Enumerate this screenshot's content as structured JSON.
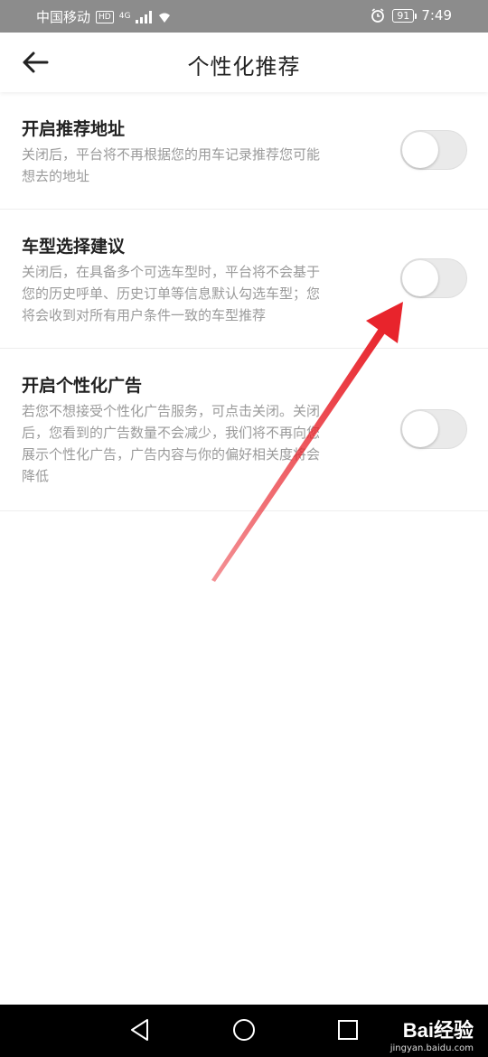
{
  "status_bar": {
    "carrier": "中国移动",
    "hd": "HD",
    "network": "4G",
    "battery": "91",
    "time": "7:49"
  },
  "header": {
    "title": "个性化推荐",
    "back_icon": "arrow-left-icon"
  },
  "settings": [
    {
      "title": "开启推荐地址",
      "desc_lines": [
        "关闭后，平台将不再根据您的用车记录推荐您可能",
        "想去的地址"
      ],
      "enabled": false
    },
    {
      "title": "车型选择建议",
      "desc_lines": [
        "关闭后，在具备多个可选车型时，平台将不会基于",
        "您的历史呼单、历史订单等信息默认勾选车型；您",
        "将会收到对所有用户条件一致的车型推荐"
      ],
      "enabled": false
    },
    {
      "title": "开启个性化广告",
      "desc_lines": [
        "若您不想接受个性化广告服务，可点击关闭。关闭",
        "后，您看到的广告数量不会减少，我们将不再向您",
        "展示个性化广告，广告内容与你的偏好相关度将会",
        "降低"
      ],
      "enabled": false
    }
  ],
  "annotation": {
    "color": "#e8242c",
    "points_to": "车型选择建议"
  },
  "nav_bar": {
    "back_icon": "triangle-back-icon",
    "home_icon": "circle-home-icon",
    "recents_icon": "square-recents-icon"
  },
  "watermark": {
    "brand": "Bai经验",
    "url": "jingyan.baidu.com"
  }
}
